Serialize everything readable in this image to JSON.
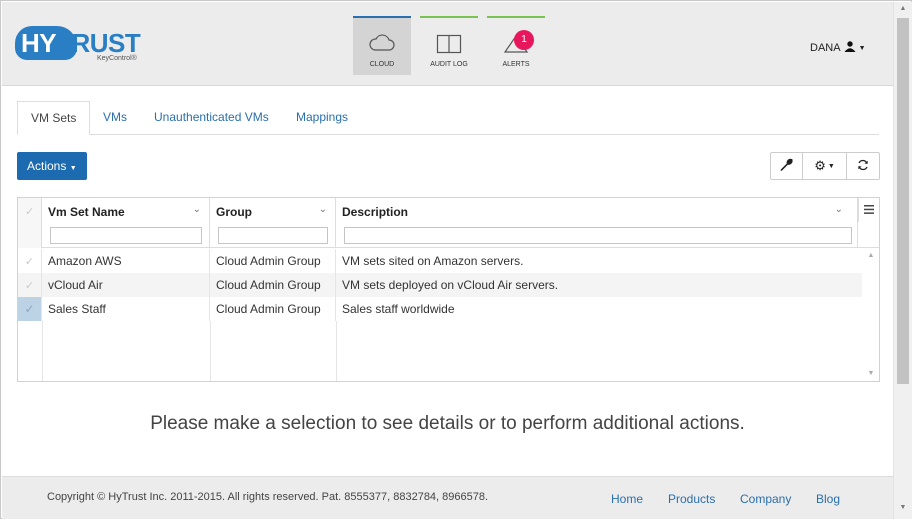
{
  "brand": {
    "name_part1": "HY",
    "name_part2": "TRUST",
    "product": "KeyControl®"
  },
  "nav": [
    {
      "label": "CLOUD",
      "icon": "cloud-icon",
      "active": true
    },
    {
      "label": "AUDIT LOG",
      "icon": "book-icon",
      "active": false
    },
    {
      "label": "ALERTS",
      "icon": "warning-icon",
      "active": false,
      "badge": "1"
    }
  ],
  "user": {
    "name": "DANA",
    "icon": "user-icon"
  },
  "tabs": [
    "VM Sets",
    "VMs",
    "Unauthenticated VMs",
    "Mappings"
  ],
  "toolbar": {
    "actions_label": "Actions",
    "wrench_icon": "wrench-icon",
    "gear_icon": "gear-icon",
    "refresh_icon": "refresh-icon"
  },
  "grid": {
    "columns": [
      "Vm Set Name",
      "Group",
      "Description"
    ],
    "rows": [
      {
        "name": "Amazon AWS",
        "group": "Cloud Admin Group",
        "description": "VM sets sited on Amazon servers."
      },
      {
        "name": "vCloud Air",
        "group": "Cloud Admin Group",
        "description": "VM sets deployed on vCloud Air servers."
      },
      {
        "name": "Sales Staff",
        "group": "Cloud Admin Group",
        "description": "Sales staff worldwide"
      }
    ]
  },
  "message": "Please make a selection to see details or to perform additional actions.",
  "footer": {
    "copyright": "Copyright © HyTrust Inc. 2011-2015. All rights reserved. Pat. 8555377, 8832784, 8966578.",
    "links": [
      "Home",
      "Products",
      "Company",
      "Blog"
    ]
  },
  "colors": {
    "accent": "#1c6bb0",
    "badge": "#e8175d",
    "tab_active_bar": "#2a6fae",
    "tab_bar": "#79c352"
  }
}
